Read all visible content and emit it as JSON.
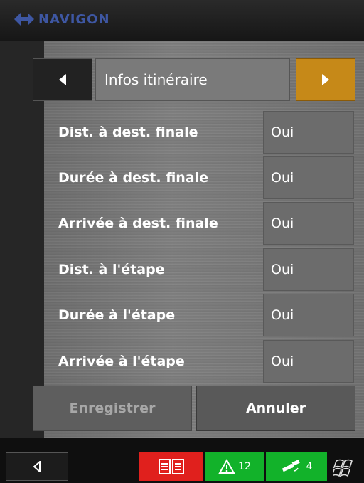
{
  "header": {
    "logo_text": "NAVIGON"
  },
  "nav": {
    "title": "Infos itinéraire",
    "prev_icon": "triangle-left-icon",
    "next_icon": "triangle-right-icon"
  },
  "settings": [
    {
      "label": "Dist. à dest. finale",
      "value": "Oui"
    },
    {
      "label": "Durée à dest. finale",
      "value": "Oui"
    },
    {
      "label": "Arrivée à dest. finale",
      "value": "Oui"
    },
    {
      "label": "Dist. à l'étape",
      "value": "Oui"
    },
    {
      "label": "Durée à l'étape",
      "value": "Oui"
    },
    {
      "label": "Arrivée à l'étape",
      "value": "Oui"
    }
  ],
  "buttons": {
    "save": "Enregistrer",
    "cancel": "Annuler"
  },
  "statusbar": {
    "warning_count": "12",
    "gps_count": "4"
  },
  "colors": {
    "accent": "#c68918",
    "book": "#e0201d",
    "status_green": "#12b22a",
    "logo": "#3e57a3"
  }
}
